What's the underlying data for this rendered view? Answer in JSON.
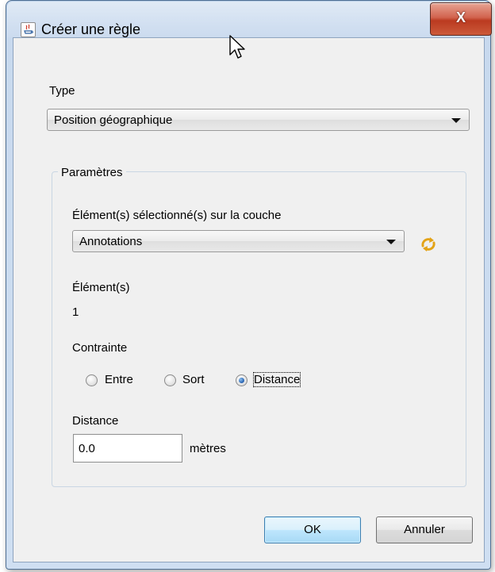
{
  "window": {
    "title": "Créer une règle",
    "close_glyph": "X"
  },
  "type_section": {
    "label": "Type",
    "selected": "Position géographique"
  },
  "params": {
    "group_title": "Paramètres",
    "layer_label": "Élément(s) sélectionné(s) sur la couche",
    "layer_selected": "Annotations",
    "refresh_icon": "refresh-icon",
    "elements_label": "Élément(s)",
    "elements_count": "1",
    "constraint_label": "Contrainte",
    "constraint_options": [
      "Entre",
      "Sort",
      "Distance"
    ],
    "constraint_selected": "Distance",
    "distance_label": "Distance",
    "distance_value": "0.0",
    "distance_unit": "mètres"
  },
  "buttons": {
    "ok": "OK",
    "cancel": "Annuler"
  },
  "colors": {
    "accent": "#3c7fb1",
    "close": "#c94a30",
    "refresh": "#e3a317"
  }
}
